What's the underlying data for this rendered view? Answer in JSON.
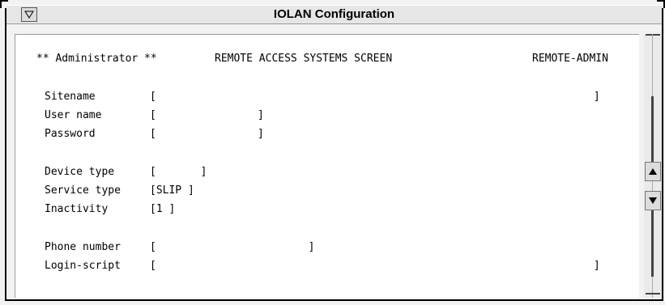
{
  "window": {
    "title": "IOLAN Configuration"
  },
  "header": {
    "role": "** Administrator **",
    "screen_title": "REMOTE ACCESS SYSTEMS SCREEN",
    "screen_id": "REMOTE-ADMIN"
  },
  "fields": {
    "sitename": {
      "label": "Sitename",
      "value": "[                                                                     ]"
    },
    "user_name": {
      "label": "User name",
      "value": "[                ]"
    },
    "password": {
      "label": "Password",
      "value": "[                ]"
    },
    "device_type": {
      "label": "Device type",
      "value": "[       ]"
    },
    "service_type": {
      "label": "Service type",
      "value": "[SLIP ]"
    },
    "inactivity": {
      "label": "Inactivity",
      "value": "[1 ]"
    },
    "phone_number": {
      "label": "Phone number",
      "value": "[                        ]"
    },
    "login_script": {
      "label": "Login-script",
      "value": "[                                                                     ]"
    }
  },
  "icons": {
    "window_menu": "down-triangle-icon",
    "scroll_up": "up-triangle-icon",
    "scroll_down": "down-triangle-icon"
  }
}
